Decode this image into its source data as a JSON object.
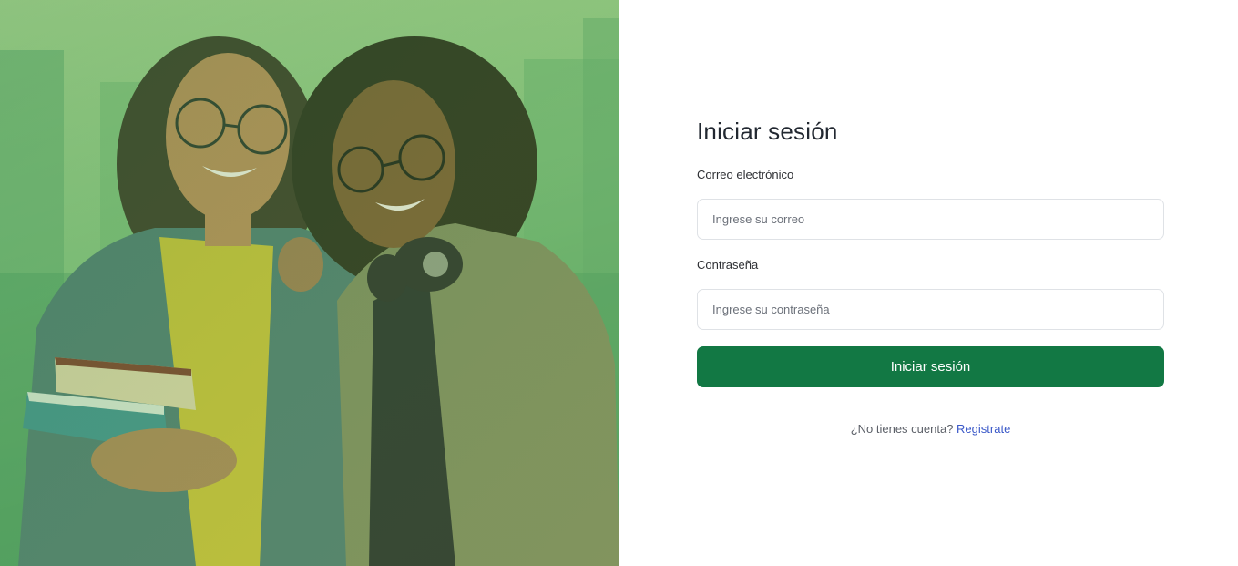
{
  "login": {
    "title": "Iniciar sesión",
    "email_label": "Correo electrónico",
    "email_placeholder": "Ingrese su correo",
    "email_value": "",
    "password_label": "Contraseña",
    "password_placeholder": "Ingrese su contraseña",
    "password_value": "",
    "submit_label": "Iniciar sesión",
    "no_account_text": "¿No tienes cuenta?",
    "register_link": "Registrate"
  },
  "colors": {
    "brand_green": "#127844",
    "link_blue": "#3a58c8",
    "hero_overlay": "#6fb46c"
  },
  "hero": {
    "image_description_icon": "students-photo"
  }
}
